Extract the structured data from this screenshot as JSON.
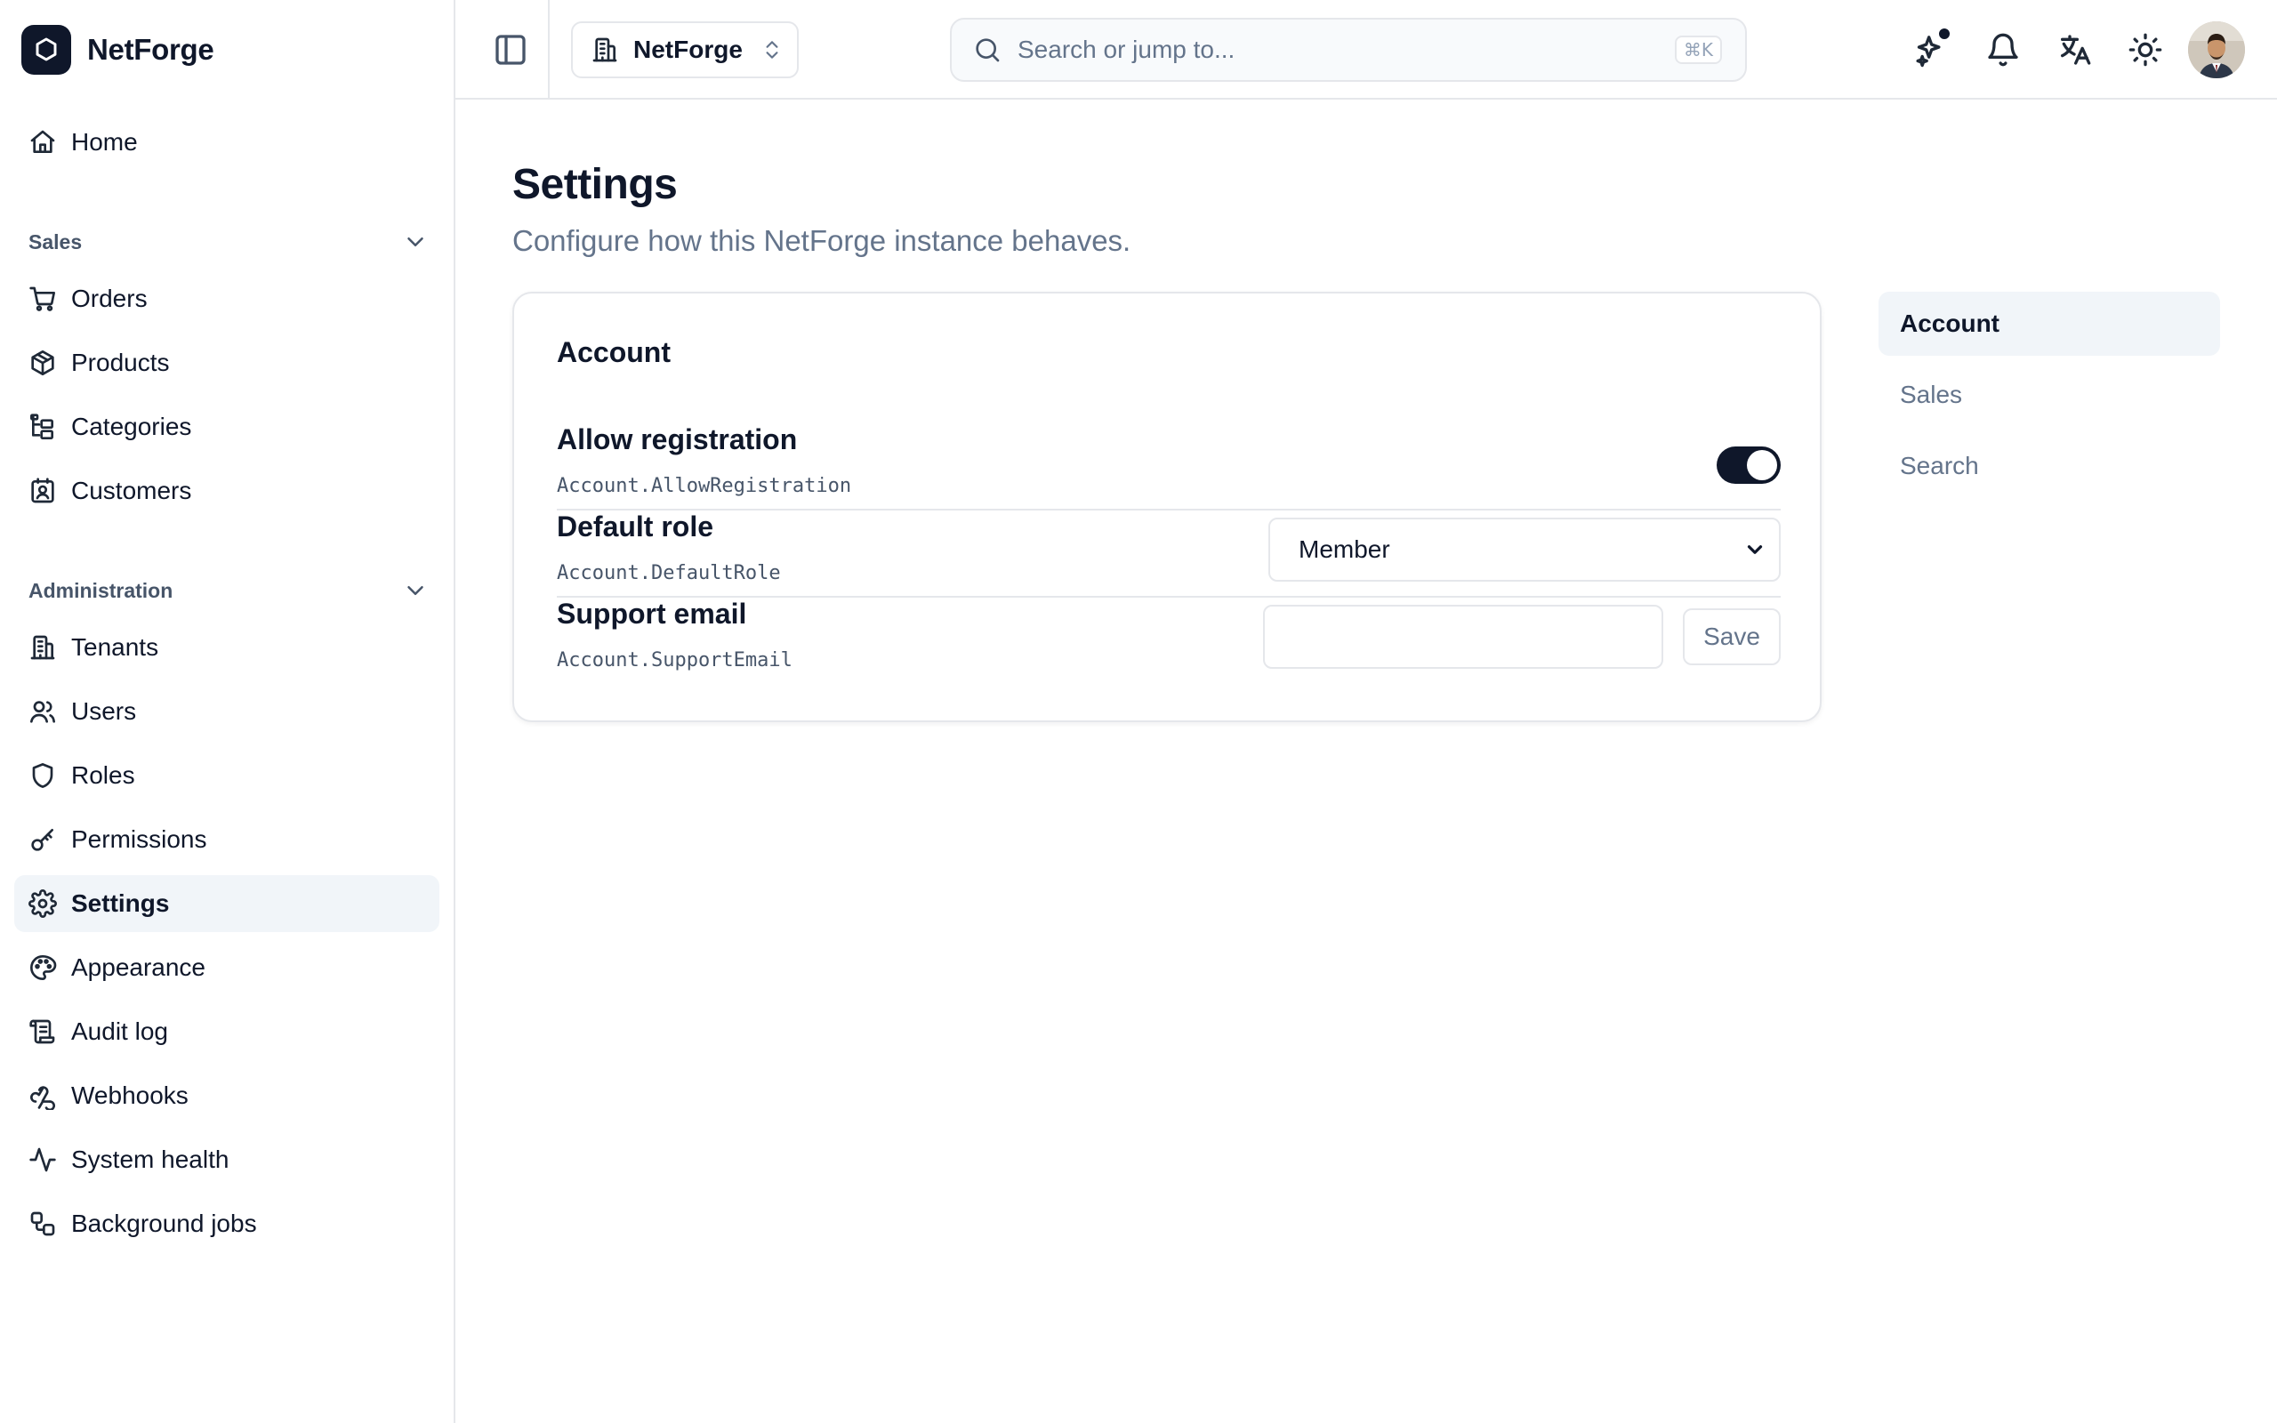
{
  "app": {
    "name": "NetForge"
  },
  "sidebar": {
    "home": {
      "label": "Home",
      "icon": "home-icon"
    },
    "sections": [
      {
        "title": "Sales",
        "items": [
          {
            "label": "Orders",
            "icon": "cart-icon"
          },
          {
            "label": "Products",
            "icon": "box-icon"
          },
          {
            "label": "Categories",
            "icon": "folder-tree-icon"
          },
          {
            "label": "Customers",
            "icon": "contact-icon"
          }
        ]
      },
      {
        "title": "Administration",
        "items": [
          {
            "label": "Tenants",
            "icon": "building-icon"
          },
          {
            "label": "Users",
            "icon": "users-icon"
          },
          {
            "label": "Roles",
            "icon": "shield-icon"
          },
          {
            "label": "Permissions",
            "icon": "key-icon"
          },
          {
            "label": "Settings",
            "icon": "gear-icon",
            "active": true
          },
          {
            "label": "Appearance",
            "icon": "palette-icon"
          },
          {
            "label": "Audit log",
            "icon": "scroll-icon"
          },
          {
            "label": "Webhooks",
            "icon": "webhook-icon"
          },
          {
            "label": "System health",
            "icon": "activity-icon"
          },
          {
            "label": "Background jobs",
            "icon": "workflow-icon"
          }
        ]
      }
    ]
  },
  "header": {
    "tenant": "NetForge",
    "search_placeholder": "Search or jump to...",
    "search_shortcut": "⌘K"
  },
  "page": {
    "title": "Settings",
    "subtitle": "Configure how this NetForge instance behaves."
  },
  "card": {
    "title": "Account",
    "settings": {
      "allow_registration": {
        "label": "Allow registration",
        "key": "Account.AllowRegistration",
        "enabled": true
      },
      "default_role": {
        "label": "Default role",
        "key": "Account.DefaultRole",
        "value": "Member"
      },
      "support_email": {
        "label": "Support email",
        "key": "Account.SupportEmail",
        "value": "",
        "save_label": "Save"
      }
    }
  },
  "section_nav": {
    "items": [
      {
        "label": "Account",
        "active": true
      },
      {
        "label": "Sales"
      },
      {
        "label": "Search"
      }
    ]
  },
  "colors": {
    "primary": "#0f172a",
    "muted": "#64748b",
    "border": "#e5e7eb",
    "active_bg": "#f1f5f9"
  }
}
